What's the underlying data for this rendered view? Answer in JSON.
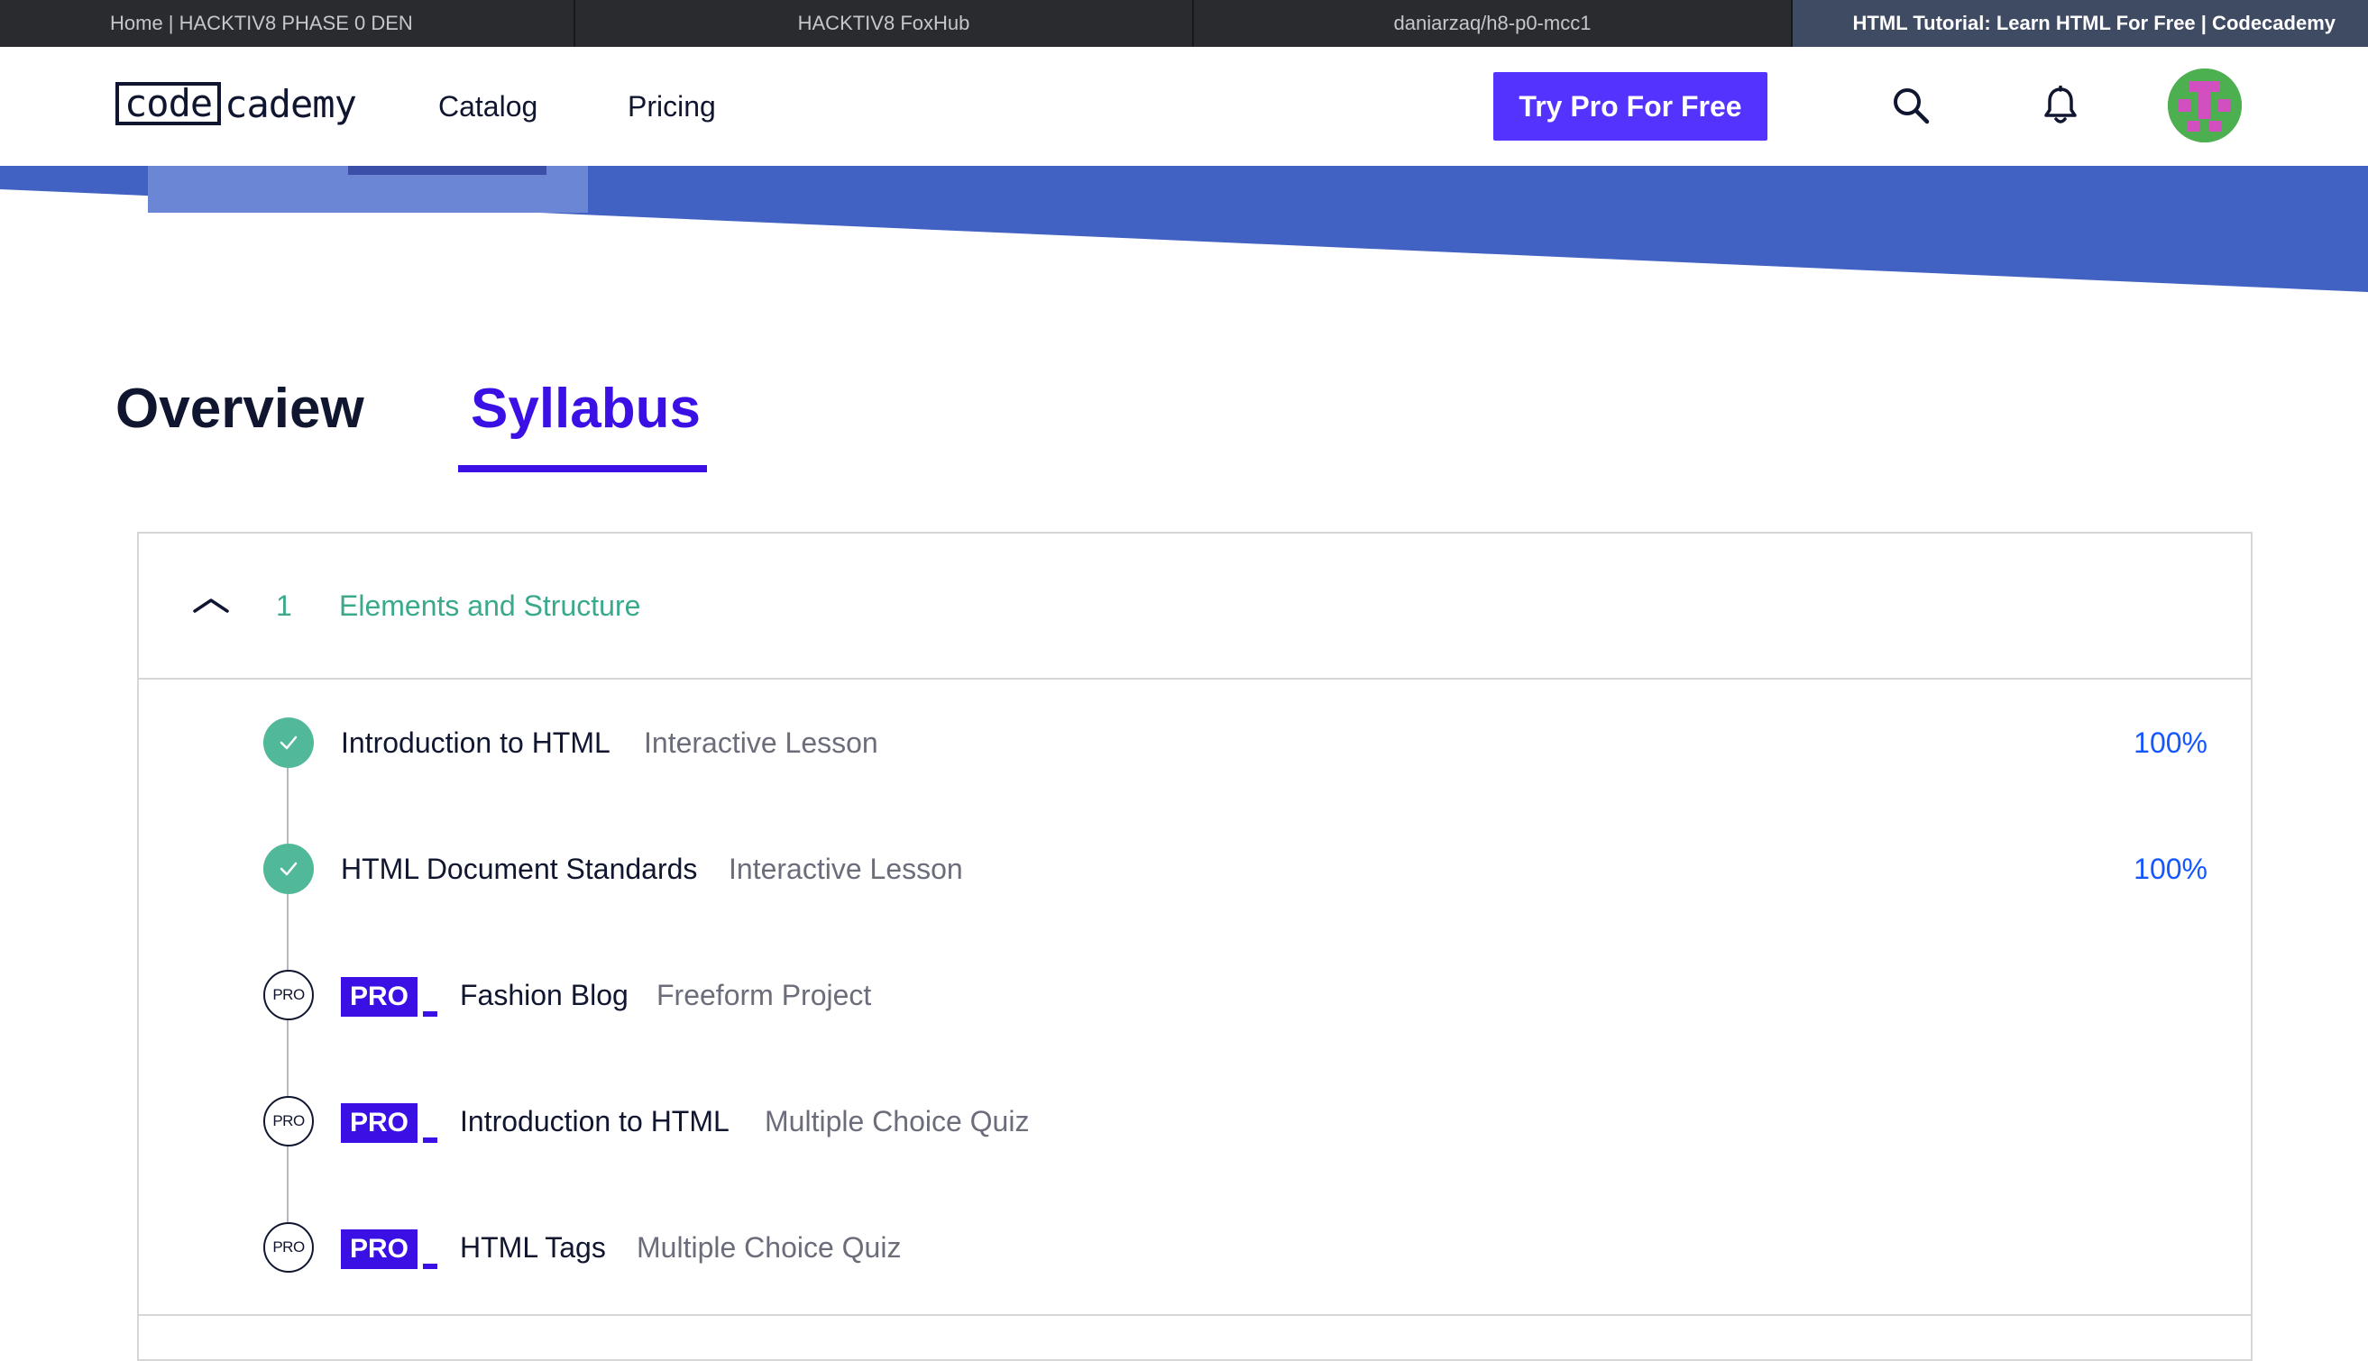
{
  "browser": {
    "tabs": [
      {
        "label": "Home | HACKTIV8 PHASE 0 DEN",
        "active": false
      },
      {
        "label": "HACKTIV8 FoxHub",
        "active": false
      },
      {
        "label": "daniarzaq/h8-p0-mcc1",
        "active": false
      },
      {
        "label": "HTML Tutorial: Learn HTML For Free | Codecademy",
        "active": true
      }
    ]
  },
  "header": {
    "logo_boxed": "code",
    "logo_rest": "cademy",
    "nav": [
      "Catalog",
      "Pricing"
    ],
    "cta_label": "Try Pro For Free",
    "icons": [
      "search-icon",
      "bell-icon",
      "avatar"
    ],
    "cta_color": "#5533ff"
  },
  "page_tabs": {
    "overview": "Overview",
    "syllabus": "Syllabus",
    "active": "Syllabus",
    "accent_color": "#3a10e5"
  },
  "syllabus": {
    "module": {
      "number": "1",
      "title": "Elements and Structure",
      "expanded": true
    },
    "items": [
      {
        "title": "Introduction to HTML",
        "type": "Interactive Lesson",
        "status": "complete",
        "progress": "100%"
      },
      {
        "title": "HTML Document Standards",
        "type": "Interactive Lesson",
        "status": "complete",
        "progress": "100%"
      },
      {
        "title": "Fashion Blog",
        "type": "Freeform Project",
        "status": "pro",
        "status_label": "PRO",
        "badge": "PRO"
      },
      {
        "title": "Introduction to HTML",
        "type": "Multiple Choice Quiz",
        "status": "pro",
        "status_label": "PRO",
        "badge": "PRO"
      },
      {
        "title": "HTML Tags",
        "type": "Multiple Choice Quiz",
        "status": "pro",
        "status_label": "PRO",
        "badge": "PRO"
      }
    ]
  }
}
